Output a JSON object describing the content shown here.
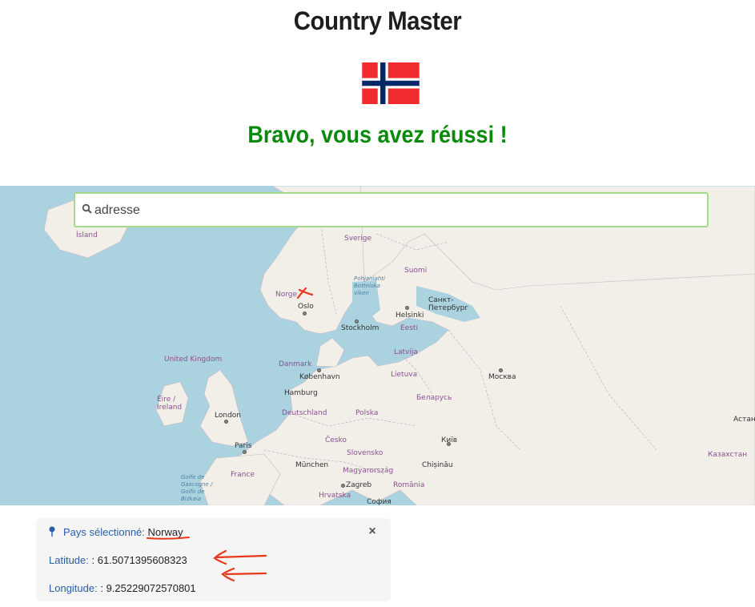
{
  "header": {
    "title": "Country Master",
    "success_message": "Bravo, vous avez réussi !"
  },
  "flag": {
    "country": "Norway",
    "colors": {
      "red": "#ef2b2d",
      "blue": "#002868",
      "white": "#ffffff"
    }
  },
  "search": {
    "placeholder": "adresse",
    "value": ""
  },
  "map": {
    "labels": {
      "island": "Ísland",
      "sverige": "Sverige",
      "suomi": "Suomi",
      "norge": "Norge",
      "oslo": "Oslo",
      "gulf_bothnia": "Pohjanlahti Bottniska viken",
      "spb": "Санкт-Петербург",
      "helsinki": "Helsinki",
      "stockholm": "Stockholm",
      "eesti": "Eesti",
      "uk": "United Kingdom",
      "latvija": "Latvija",
      "danmark": "Danmark",
      "kobenhavn": "København",
      "lietuva": "Lietuva",
      "moskva": "Москва",
      "hamburg": "Hamburg",
      "belarus": "Беларусь",
      "ireland": "Éire / Ireland",
      "london": "London",
      "deutschland": "Deutschland",
      "polska": "Polska",
      "astana": "Астана",
      "paris": "Paris",
      "cesko": "Česko",
      "kyiv": "Київ",
      "slovensko": "Slovensko",
      "kazakhstan": "Казахстан",
      "munchen": "München",
      "chisinau": "Chișinău",
      "france": "France",
      "magyarorszag": "Magyarország",
      "biscay": "Golfe de Gascogne / Golfo de Bizkaia",
      "zagreb": "Zagreb",
      "romania": "România",
      "hrvatska": "Hrvatska",
      "sofia": "София"
    }
  },
  "info": {
    "selected_label": "Pays sélectionné:",
    "selected_value": "Norway",
    "latitude_label": "Latitude:",
    "latitude_value": ": 61.5071395608323",
    "longitude_label": "Longitude:",
    "longitude_value": ": 9.25229072570801",
    "close_label": "×"
  }
}
